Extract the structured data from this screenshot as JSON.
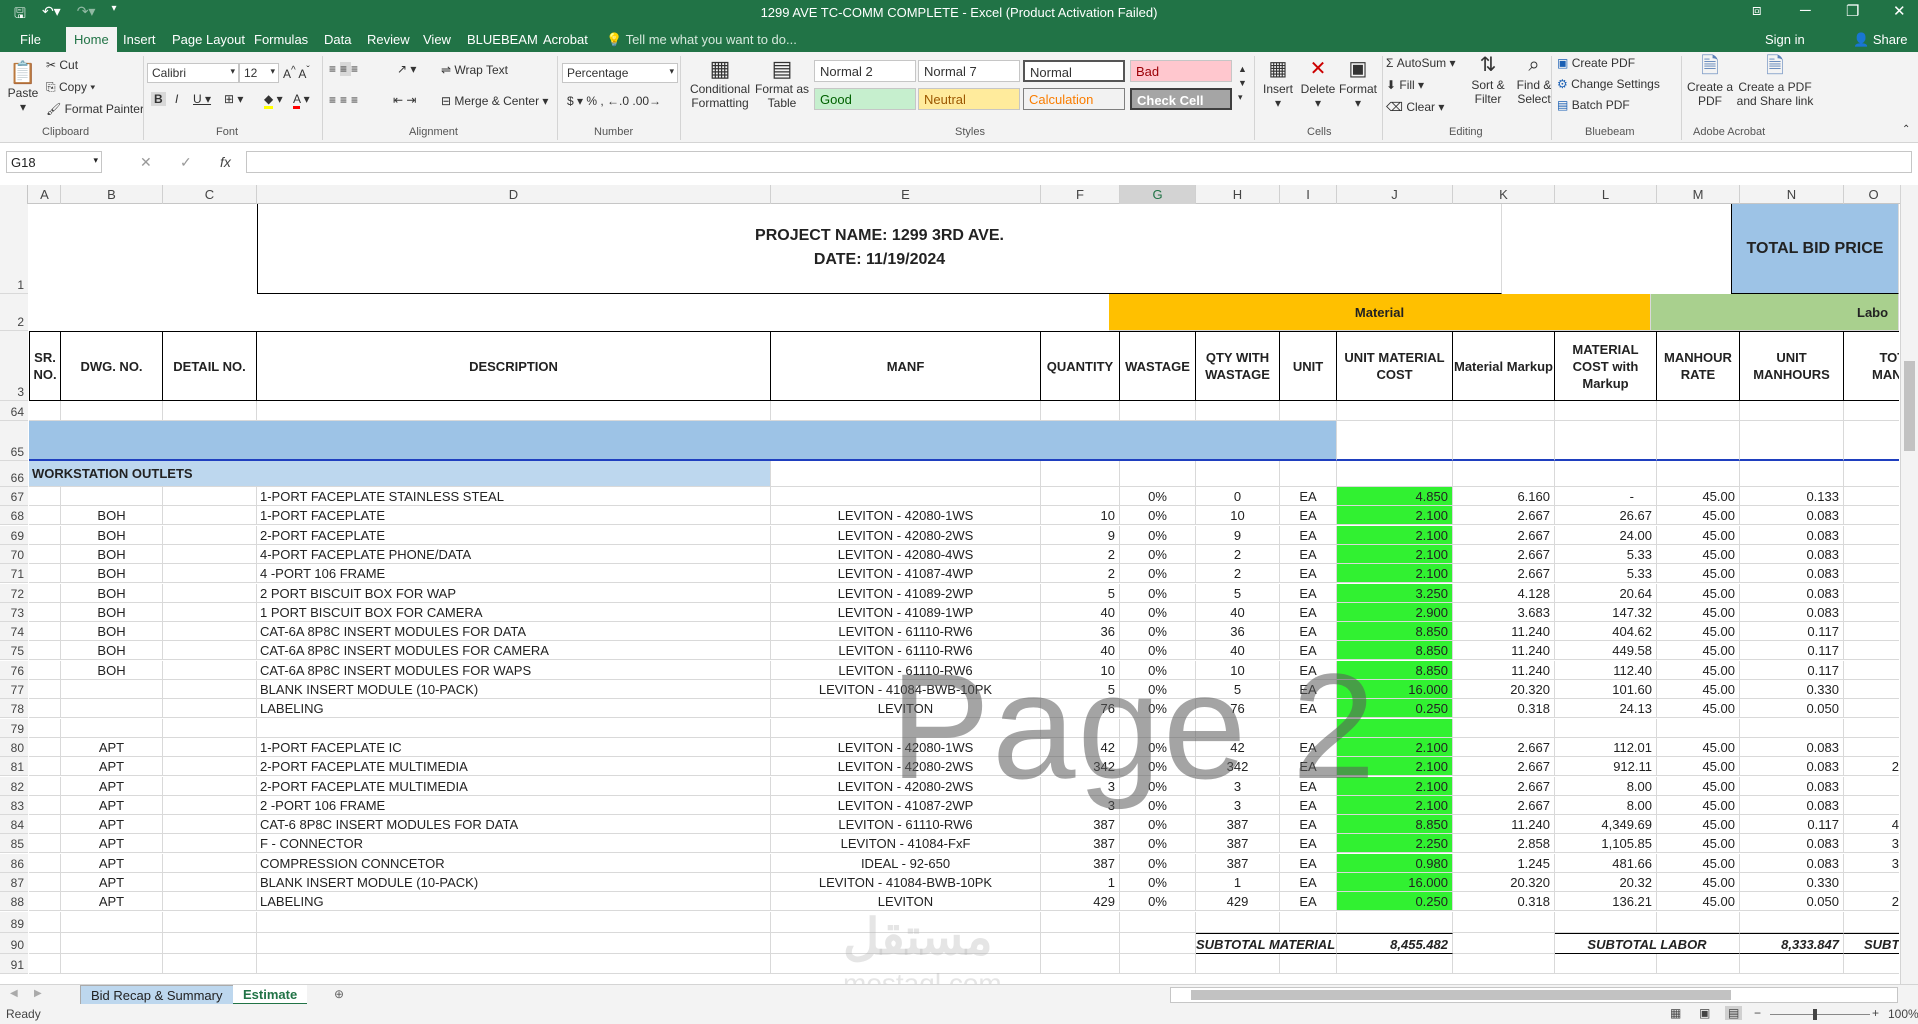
{
  "window": {
    "title": "1299 AVE TC-COMM COMPLETE - Excel (Product Activation Failed)"
  },
  "ribbon_tabs": [
    "File",
    "Home",
    "Insert",
    "Page Layout",
    "Formulas",
    "Data",
    "Review",
    "View",
    "BLUEBEAM",
    "Acrobat"
  ],
  "tellme": "Tell me what you want to do...",
  "signin": "Sign in",
  "share": "Share",
  "clipboard": {
    "paste": "Paste",
    "cut": "Cut",
    "copy": "Copy",
    "format_painter": "Format Painter",
    "label": "Clipboard"
  },
  "font": {
    "name": "Calibri",
    "size": "12",
    "label": "Font"
  },
  "alignment": {
    "wrap": "Wrap Text",
    "merge": "Merge & Center",
    "label": "Alignment"
  },
  "number": {
    "format": "Percentage",
    "label": "Number"
  },
  "styles": {
    "conditional": "Conditional Formatting",
    "format_as": "Format as Table",
    "items": [
      "Normal 2",
      "Normal 7",
      "Normal",
      "Bad",
      "Good",
      "Neutral",
      "Calculation",
      "Check Cell"
    ],
    "label": "Styles"
  },
  "cells": {
    "insert": "Insert",
    "delete": "Delete",
    "format": "Format",
    "label": "Cells"
  },
  "editing": {
    "autosum": "AutoSum",
    "fill": "Fill",
    "clear": "Clear",
    "sort": "Sort & Filter",
    "find": "Find & Select",
    "label": "Editing"
  },
  "bluebeam": {
    "create": "Create PDF",
    "change": "Change Settings",
    "batch": "Batch PDF",
    "label": "Bluebeam"
  },
  "acrobat": {
    "create": "Create a PDF",
    "share": "Create a PDF and Share link",
    "label": "Adobe Acrobat"
  },
  "namebox": "G18",
  "columns": [
    "A",
    "B",
    "C",
    "D",
    "E",
    "F",
    "G",
    "H",
    "I",
    "J",
    "K",
    "L",
    "M",
    "N",
    "O"
  ],
  "project": {
    "name": "PROJECT NAME:  1299 3RD AVE.",
    "date": "DATE: 11/19/2024",
    "total_bid": "TOTAL BID PRICE",
    "material": "Material",
    "labor": "Labo"
  },
  "headers": [
    "SR. NO.",
    "DWG. NO.",
    "DETAIL NO.",
    "DESCRIPTION",
    "MANF",
    "QUANTITY",
    "WASTAGE",
    "QTY WITH WASTAGE",
    "UNIT",
    "UNIT MATERIAL COST",
    "Material Markup",
    "MATERIAL COST with Markup",
    "MANHOUR RATE",
    "UNIT MANHOURS",
    "TOTA MANHO"
  ],
  "section": "WORKSTATION OUTLETS",
  "rows": [
    {
      "r": "67",
      "b": "",
      "d": "1-PORT FACEPLATE STAINLESS STEAL",
      "e": "",
      "f": "",
      "g": "0%",
      "h": "0",
      "i": "EA",
      "j": "4.850",
      "k": "6.160",
      "l": "-",
      "m": "45.00",
      "n": "0.133",
      "o": ""
    },
    {
      "r": "68",
      "b": "BOH",
      "d": "1-PORT FACEPLATE",
      "e": "LEVITON - 42080-1WS",
      "f": "10",
      "g": "0%",
      "h": "10",
      "i": "EA",
      "j": "2.100",
      "k": "2.667",
      "l": "26.67",
      "m": "45.00",
      "n": "0.083",
      "o": ""
    },
    {
      "r": "69",
      "b": "BOH",
      "d": "2-PORT FACEPLATE",
      "e": "LEVITON - 42080-2WS",
      "f": "9",
      "g": "0%",
      "h": "9",
      "i": "EA",
      "j": "2.100",
      "k": "2.667",
      "l": "24.00",
      "m": "45.00",
      "n": "0.083",
      "o": ""
    },
    {
      "r": "70",
      "b": "BOH",
      "d": "4-PORT FACEPLATE PHONE/DATA",
      "e": "LEVITON - 42080-4WS",
      "f": "2",
      "g": "0%",
      "h": "2",
      "i": "EA",
      "j": "2.100",
      "k": "2.667",
      "l": "5.33",
      "m": "45.00",
      "n": "0.083",
      "o": ""
    },
    {
      "r": "71",
      "b": "BOH",
      "d": "4 -PORT 106 FRAME",
      "e": "LEVITON - 41087-4WP",
      "f": "2",
      "g": "0%",
      "h": "2",
      "i": "EA",
      "j": "2.100",
      "k": "2.667",
      "l": "5.33",
      "m": "45.00",
      "n": "0.083",
      "o": ""
    },
    {
      "r": "72",
      "b": "BOH",
      "d": "2 PORT BISCUIT BOX FOR WAP",
      "e": "LEVITON - 41089-2WP",
      "f": "5",
      "g": "0%",
      "h": "5",
      "i": "EA",
      "j": "3.250",
      "k": "4.128",
      "l": "20.64",
      "m": "45.00",
      "n": "0.083",
      "o": ""
    },
    {
      "r": "73",
      "b": "BOH",
      "d": "1 PORT BISCUIT BOX FOR CAMERA",
      "e": "LEVITON - 41089-1WP",
      "f": "40",
      "g": "0%",
      "h": "40",
      "i": "EA",
      "j": "2.900",
      "k": "3.683",
      "l": "147.32",
      "m": "45.00",
      "n": "0.083",
      "o": ""
    },
    {
      "r": "74",
      "b": "BOH",
      "d": "CAT-6A 8P8C INSERT MODULES FOR DATA",
      "e": "LEVITON - 61110-RW6",
      "f": "36",
      "g": "0%",
      "h": "36",
      "i": "EA",
      "j": "8.850",
      "k": "11.240",
      "l": "404.62",
      "m": "45.00",
      "n": "0.117",
      "o": ""
    },
    {
      "r": "75",
      "b": "BOH",
      "d": "CAT-6A 8P8C INSERT MODULES FOR CAMERA",
      "e": "LEVITON - 61110-RW6",
      "f": "40",
      "g": "0%",
      "h": "40",
      "i": "EA",
      "j": "8.850",
      "k": "11.240",
      "l": "449.58",
      "m": "45.00",
      "n": "0.117",
      "o": ""
    },
    {
      "r": "76",
      "b": "BOH",
      "d": "CAT-6A 8P8C INSERT MODULES FOR WAPS",
      "e": "LEVITON - 61110-RW6",
      "f": "10",
      "g": "0%",
      "h": "10",
      "i": "EA",
      "j": "8.850",
      "k": "11.240",
      "l": "112.40",
      "m": "45.00",
      "n": "0.117",
      "o": ""
    },
    {
      "r": "77",
      "b": "",
      "d": "BLANK INSERT MODULE (10-PACK)",
      "e": "LEVITON - 41084-BWB-10PK",
      "f": "5",
      "g": "0%",
      "h": "5",
      "i": "EA",
      "j": "16.000",
      "k": "20.320",
      "l": "101.60",
      "m": "45.00",
      "n": "0.330",
      "o": ""
    },
    {
      "r": "78",
      "b": "",
      "d": "LABELING",
      "e": "LEVITON",
      "f": "76",
      "g": "0%",
      "h": "76",
      "i": "EA",
      "j": "0.250",
      "k": "0.318",
      "l": "24.13",
      "m": "45.00",
      "n": "0.050",
      "o": ""
    },
    {
      "r": "79",
      "blank": true
    },
    {
      "r": "80",
      "b": "APT",
      "d": "1-PORT FACEPLATE IC",
      "e": "LEVITON - 42080-1WS",
      "f": "42",
      "g": "0%",
      "h": "42",
      "i": "EA",
      "j": "2.100",
      "k": "2.667",
      "l": "112.01",
      "m": "45.00",
      "n": "0.083",
      "o": ""
    },
    {
      "r": "81",
      "b": "APT",
      "d": "2-PORT FACEPLATE MULTIMEDIA",
      "e": "LEVITON - 42080-2WS",
      "f": "342",
      "g": "0%",
      "h": "342",
      "i": "EA",
      "j": "2.100",
      "k": "2.667",
      "l": "912.11",
      "m": "45.00",
      "n": "0.083",
      "o": "2"
    },
    {
      "r": "82",
      "b": "APT",
      "d": "2-PORT FACEPLATE MULTIMEDIA",
      "e": "LEVITON - 42080-2WS",
      "f": "3",
      "g": "0%",
      "h": "3",
      "i": "EA",
      "j": "2.100",
      "k": "2.667",
      "l": "8.00",
      "m": "45.00",
      "n": "0.083",
      "o": ""
    },
    {
      "r": "83",
      "b": "APT",
      "d": "2 -PORT 106 FRAME",
      "e": "LEVITON - 41087-2WP",
      "f": "3",
      "g": "0%",
      "h": "3",
      "i": "EA",
      "j": "2.100",
      "k": "2.667",
      "l": "8.00",
      "m": "45.00",
      "n": "0.083",
      "o": ""
    },
    {
      "r": "84",
      "b": "APT",
      "d": "CAT-6 8P8C INSERT MODULES FOR DATA",
      "e": "LEVITON - 61110-RW6",
      "f": "387",
      "g": "0%",
      "h": "387",
      "i": "EA",
      "j": "8.850",
      "k": "11.240",
      "l": "4,349.69",
      "m": "45.00",
      "n": "0.117",
      "o": "4"
    },
    {
      "r": "85",
      "b": "APT",
      "d": "F - CONNECTOR",
      "e": "LEVITON - 41084-FxF",
      "f": "387",
      "g": "0%",
      "h": "387",
      "i": "EA",
      "j": "2.250",
      "k": "2.858",
      "l": "1,105.85",
      "m": "45.00",
      "n": "0.083",
      "o": "3"
    },
    {
      "r": "86",
      "b": "APT",
      "d": "COMPRESSION CONNCETOR",
      "e": "IDEAL - 92-650",
      "f": "387",
      "g": "0%",
      "h": "387",
      "i": "EA",
      "j": "0.980",
      "k": "1.245",
      "l": "481.66",
      "m": "45.00",
      "n": "0.083",
      "o": "3"
    },
    {
      "r": "87",
      "b": "APT",
      "d": "BLANK INSERT MODULE (10-PACK)",
      "e": "LEVITON - 41084-BWB-10PK",
      "f": "1",
      "g": "0%",
      "h": "1",
      "i": "EA",
      "j": "16.000",
      "k": "20.320",
      "l": "20.32",
      "m": "45.00",
      "n": "0.330",
      "o": ""
    },
    {
      "r": "88",
      "b": "APT",
      "d": "LABELING",
      "e": "LEVITON",
      "f": "429",
      "g": "0%",
      "h": "429",
      "i": "EA",
      "j": "0.250",
      "k": "0.318",
      "l": "136.21",
      "m": "45.00",
      "n": "0.050",
      "o": "2"
    }
  ],
  "subtotal": {
    "material_label": "SUBTOTAL MATERIAL",
    "material_value": "8,455.482",
    "labor_label": "SUBTOTAL LABOR",
    "labor_value": "8,333.847",
    "sub": "SUBT"
  },
  "watermark": "Page 2",
  "sheets": [
    "Bid Recap & Summary",
    "Estimate"
  ],
  "status": {
    "ready": "Ready",
    "zoom": "100%"
  }
}
